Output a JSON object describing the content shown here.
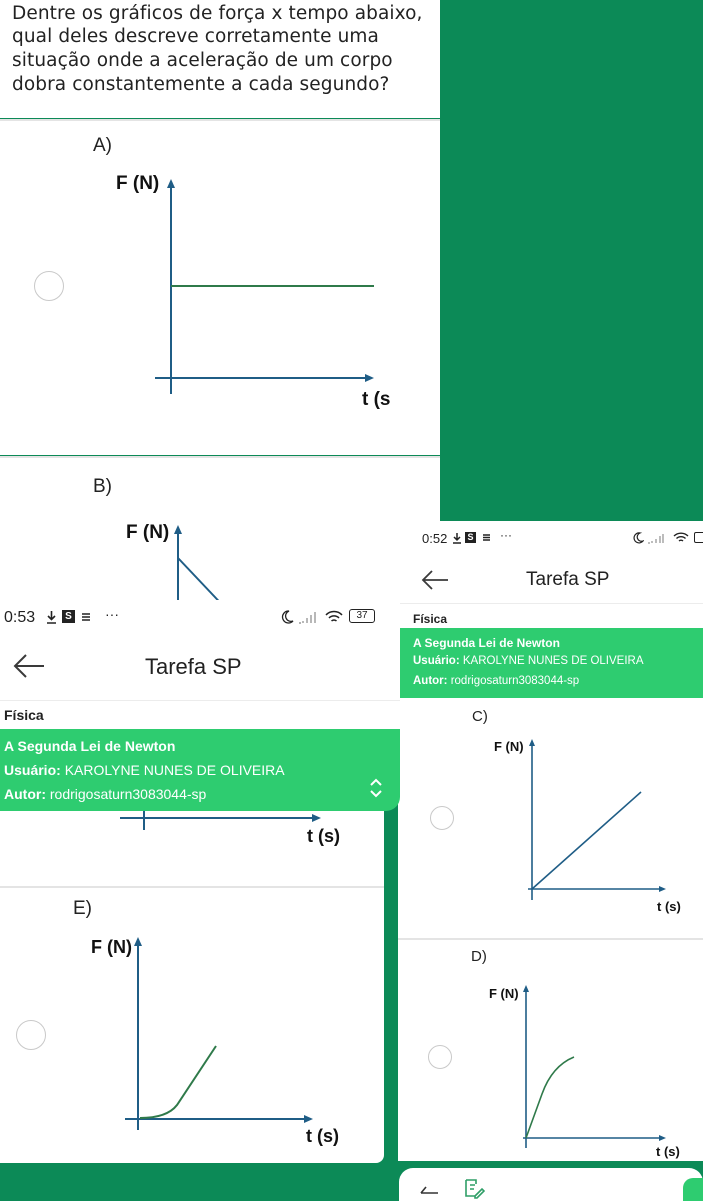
{
  "question": {
    "lines": [
      "Dentre os gráficos de força x tempo abaixo,",
      "qual deles descreve corretamente uma",
      "situação onde a aceleração de um corpo",
      "dobra constantemente a cada segundo?"
    ]
  },
  "options": {
    "a": {
      "letter": "A)",
      "ylabel": "F (N)",
      "xlabel": "t (s)"
    },
    "b": {
      "letter": "B)",
      "ylabel": "F (N)",
      "xlabel": "t (s)"
    },
    "c": {
      "letter": "C)",
      "ylabel": "F (N)",
      "xlabel": "t (s)"
    },
    "d": {
      "letter": "D)",
      "ylabel": "F (N)",
      "xlabel": "t (s)"
    },
    "e": {
      "letter": "E)",
      "ylabel": "F (N)",
      "xlabel": "t (s)"
    }
  },
  "screen_front": {
    "status_time": "0:53",
    "status_app_letter": "S",
    "status_more": "···",
    "battery": "37",
    "app_title": "Tarefa SP",
    "subject": "Física",
    "lesson_title": "A Segunda Lei de Newton",
    "user_label": "Usuário:",
    "user_value": "KAROLYNE NUNES DE OLIVEIRA",
    "author_label": "Autor:",
    "author_value": "rodrigosaturn3083044-sp"
  },
  "screen_back": {
    "status_time": "0:52",
    "status_app_letter": "S",
    "status_more": "···",
    "app_title": "Tarefa SP",
    "subject": "Física",
    "lesson_title": "A Segunda Lei de Newton",
    "user_label": "Usuário:",
    "user_value": "KAROLYNE NUNES DE OLIVEIRA",
    "author_label": "Autor:",
    "author_value": "rodrigosaturn3083044-sp"
  },
  "colors": {
    "background_green": "#0c8a57",
    "header_green": "#2ecc70",
    "axis_blue": "#1f5d86",
    "curve_green": "#2f7a4a"
  },
  "icons": [
    "back-arrow-icon",
    "chevron-up-down-icon",
    "moon-icon",
    "signal-icon",
    "wifi-icon",
    "battery-icon",
    "download-icon",
    "nav-back-icon",
    "edit-icon"
  ]
}
